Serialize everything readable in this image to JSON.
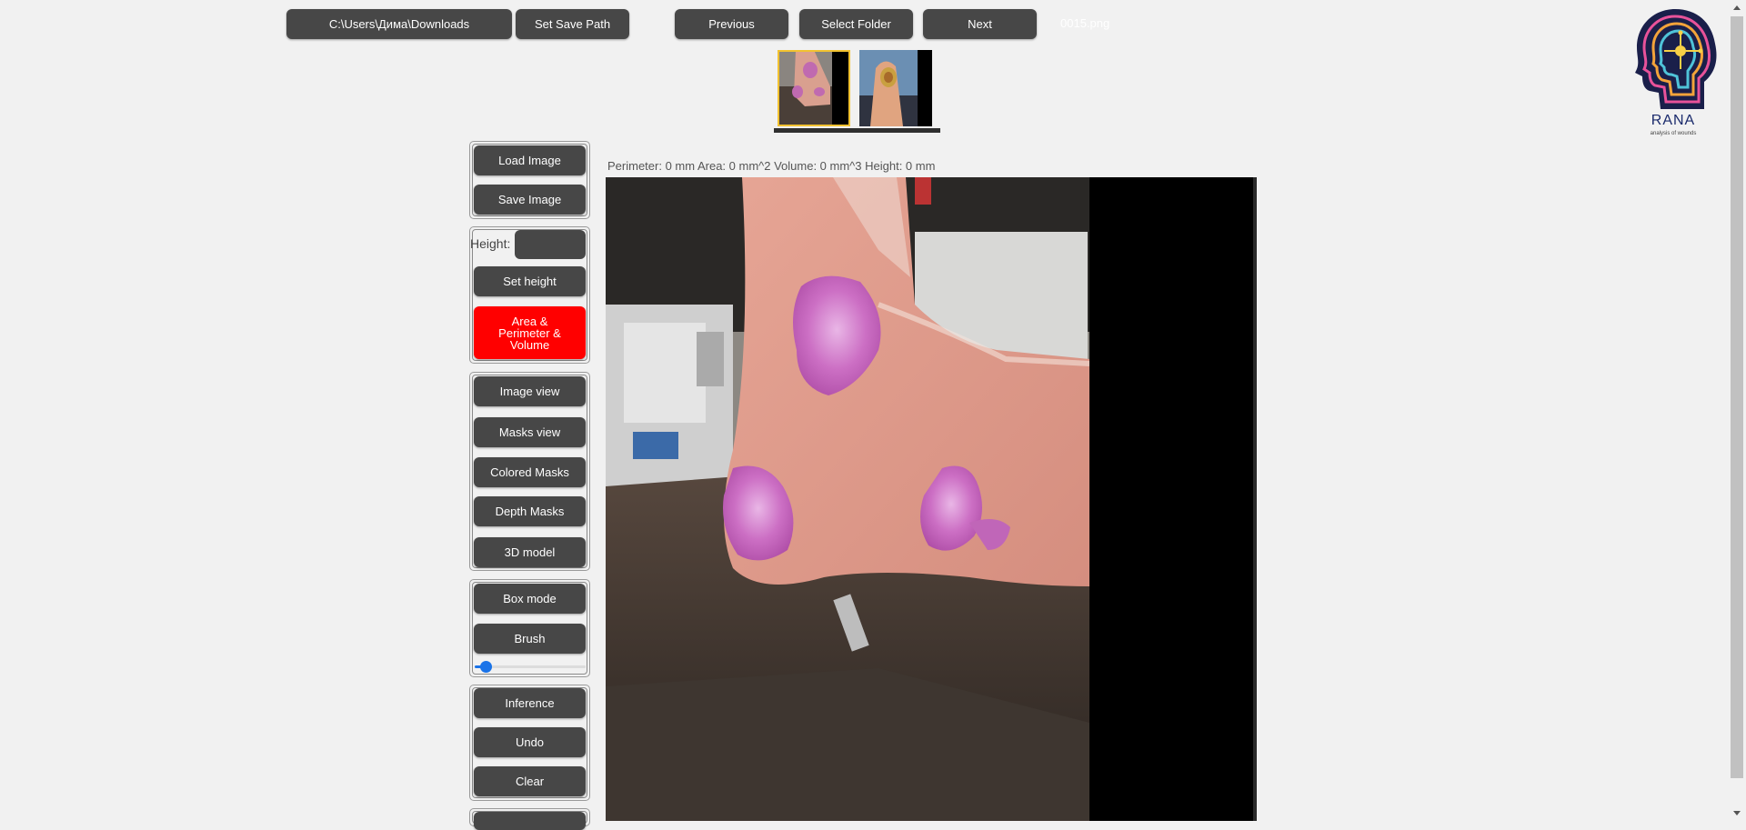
{
  "toolbar": {
    "path": "C:\\Users\\Дима\\Downloads",
    "set_save_path": "Set Save Path",
    "previous": "Previous",
    "select_folder": "Select Folder",
    "next": "Next",
    "filename": "0015.png"
  },
  "thumbnails": [
    {
      "name": "thumbnail-1",
      "selected": true
    },
    {
      "name": "thumbnail-2",
      "selected": false
    }
  ],
  "stats": "Perimeter: 0 mm Area: 0 mm^2 Volume: 0 mm^3 Height: 0 mm",
  "sidebar": {
    "load_image": "Load Image",
    "save_image": "Save Image",
    "height_label": "Height:",
    "height_value": "",
    "set_height": "Set height",
    "area_perimeter_volume": "Area & Perimeter & Volume",
    "image_view": "Image view",
    "masks_view": "Masks view",
    "colored_masks": "Colored Masks",
    "depth_masks": "Depth Masks",
    "model_3d": "3D model",
    "box_mode": "Box mode",
    "brush": "Brush",
    "brush_size": 0.1,
    "inference": "Inference",
    "undo": "Undo",
    "clear": "Clear"
  },
  "logo": {
    "name": "RANA",
    "subtitle": "analysis of wounds"
  },
  "colors": {
    "button": "#474747",
    "active": "#ff0000",
    "accent": "#1a73e8",
    "thumb_selected": "#f2c230"
  }
}
